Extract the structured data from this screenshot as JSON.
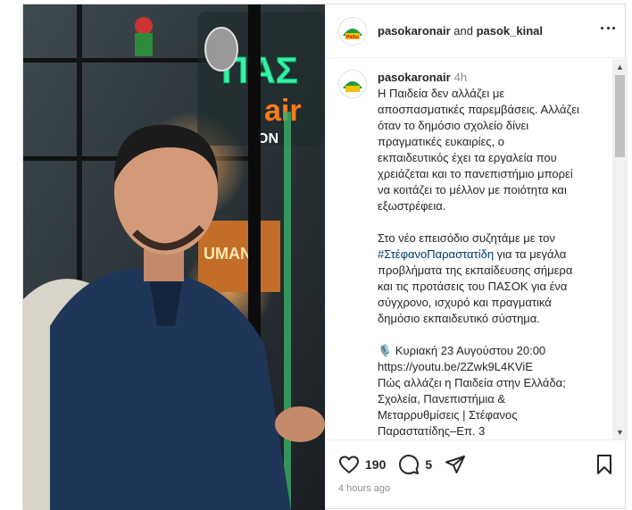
{
  "header": {
    "user1": "pasokaronair",
    "and": " and ",
    "user2": "pasok_kinal",
    "avatar_text": "Ράδιο"
  },
  "caption": {
    "user": "pasokaronair",
    "time": "4h",
    "lines": [
      "Η Παιδεία δεν αλλάζει με",
      "αποσπασματικές παρεμβάσεις. Αλλάζει",
      "όταν το δημόσιο σχολείο δίνει",
      "πραγματικές ευκαιρίες, ο",
      "εκπαιδευτικός έχει τα εργαλεία που",
      "χρειάζεται και το πανεπιστήμιο μπορεί",
      "να κοιτάζει το μέλλον με ποιότητα και",
      "εξωστρέφεια."
    ],
    "p2_line1": "Στο νέο επεισόδιο συζητάμε με τον",
    "p2_hashtag": "#ΣτέφανοΠαραστατίδη",
    "p2_line2_rest": " για τα μεγάλα",
    "p2_lines": [
      "προβλήματα της εκπαίδευσης σήμερα",
      "και τις προτάσεις του ΠΑΣΟΚ για ένα",
      "σύγχρονο, ισχυρό και πραγματικά",
      "δημόσιο εκπαιδευτικό σύστημα."
    ],
    "p3_lines": [
      "🎙️ Κυριακή 23 Αυγούστου 20:00",
      "https://youtu.be/2Zwk9L4KViE",
      "Πώς αλλάζει η Παιδεία στην Ελλάδα;",
      "Σχολεία, Πανεπιστήμια &",
      "Μεταρρυθμίσεις | Στέφανος",
      "Παραστατίδης–Επ. 3"
    ]
  },
  "actions": {
    "likes": "190",
    "comments": "5",
    "time_ago": "4 hours ago"
  },
  "icons": {
    "like": "heart-icon",
    "comment": "comment-icon",
    "share": "send-icon",
    "save": "bookmark-icon",
    "more": "more-options-icon"
  },
  "photo": {
    "sign_text": "ΠΑΣ",
    "sign_sub": "ON",
    "game_label": "UMANJ"
  },
  "colors": {
    "brand_green": "#1c9d3c",
    "link": "#00376b",
    "muted": "#8e8e8e"
  }
}
